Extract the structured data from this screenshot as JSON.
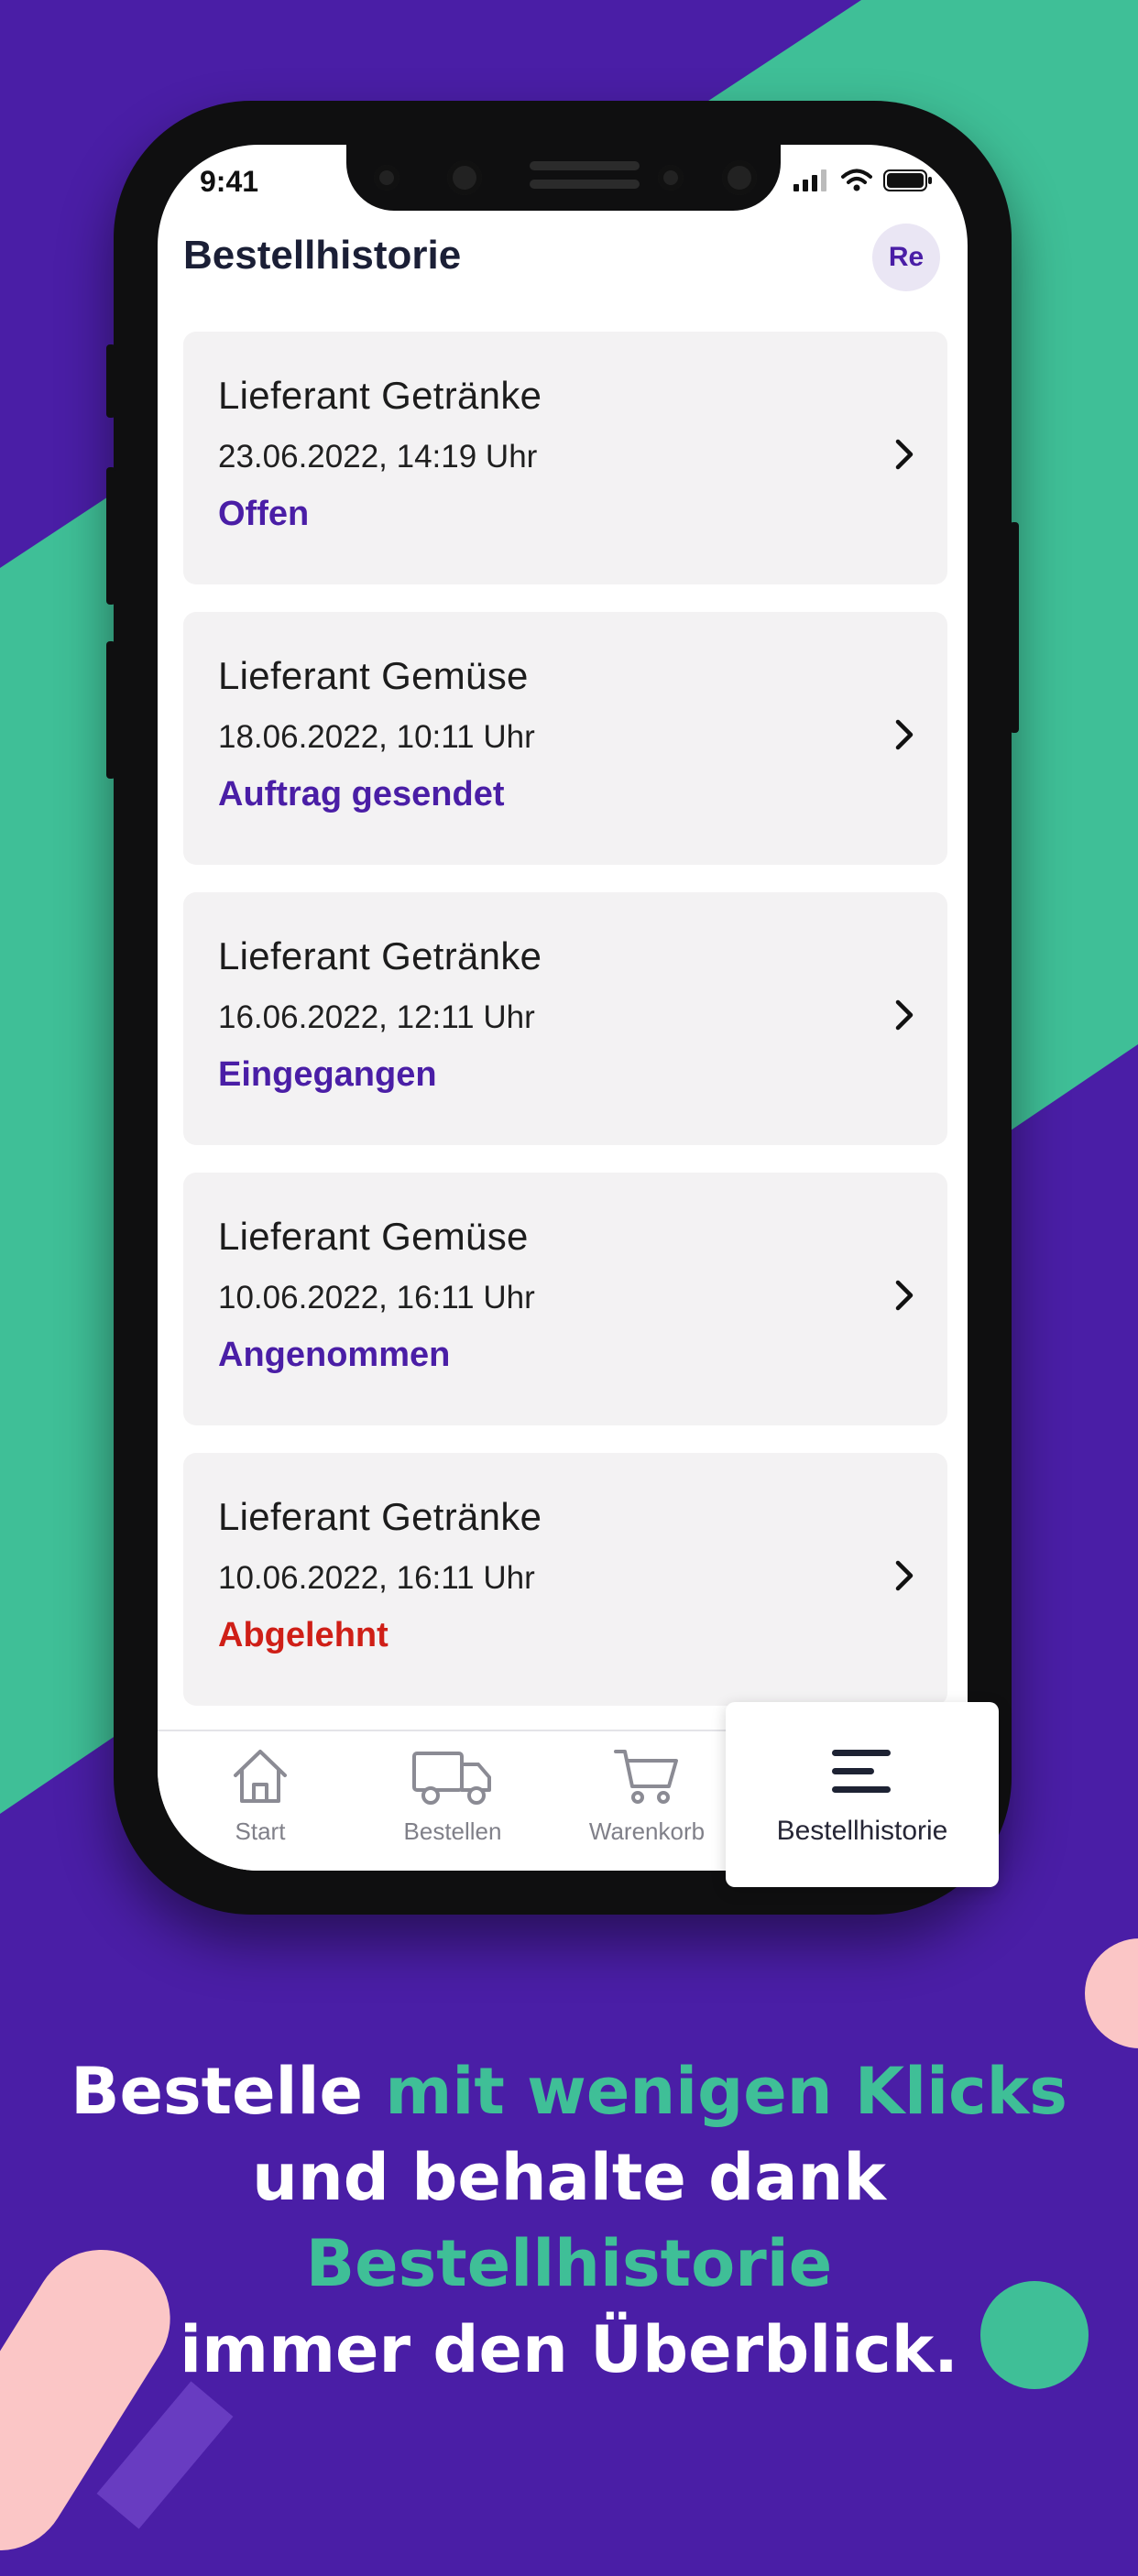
{
  "colors": {
    "brand_purple": "#4a1ea6",
    "accent_green": "#3fbf97",
    "rejected_red": "#cf1f17",
    "card_bg": "#f3f2f3",
    "pink_deco": "#fbc6c6"
  },
  "status_bar": {
    "time": "9:41"
  },
  "header": {
    "title": "Bestellhistorie",
    "avatar_initials": "Re"
  },
  "orders": [
    {
      "supplier": "Lieferant Getränke",
      "datetime": "23.06.2022, 14:19 Uhr",
      "status": "Offen"
    },
    {
      "supplier": "Lieferant Gemüse",
      "datetime": "18.06.2022, 10:11 Uhr",
      "status": "Auftrag gesendet"
    },
    {
      "supplier": "Lieferant Getränke",
      "datetime": "16.06.2022, 12:11 Uhr",
      "status": "Eingegangen"
    },
    {
      "supplier": "Lieferant Gemüse",
      "datetime": "10.06.2022, 16:11 Uhr",
      "status": "Angenommen"
    },
    {
      "supplier": "Lieferant Getränke",
      "datetime": "10.06.2022, 16:11 Uhr",
      "status": "Abgelehnt"
    }
  ],
  "tabs": [
    {
      "label": "Start",
      "icon": "home-icon"
    },
    {
      "label": "Bestellen",
      "icon": "truck-icon"
    },
    {
      "label": "Warenkorb",
      "icon": "cart-icon"
    },
    {
      "label": "Bestellhistorie",
      "icon": "history-icon",
      "active": true
    }
  ],
  "headline": {
    "line1_a": "Bestelle ",
    "line1_b": "mit wenigen Klicks",
    "line2_a": "und behalte dank ",
    "line2_b": "Bestellhistorie",
    "line3": "immer den Überblick."
  }
}
